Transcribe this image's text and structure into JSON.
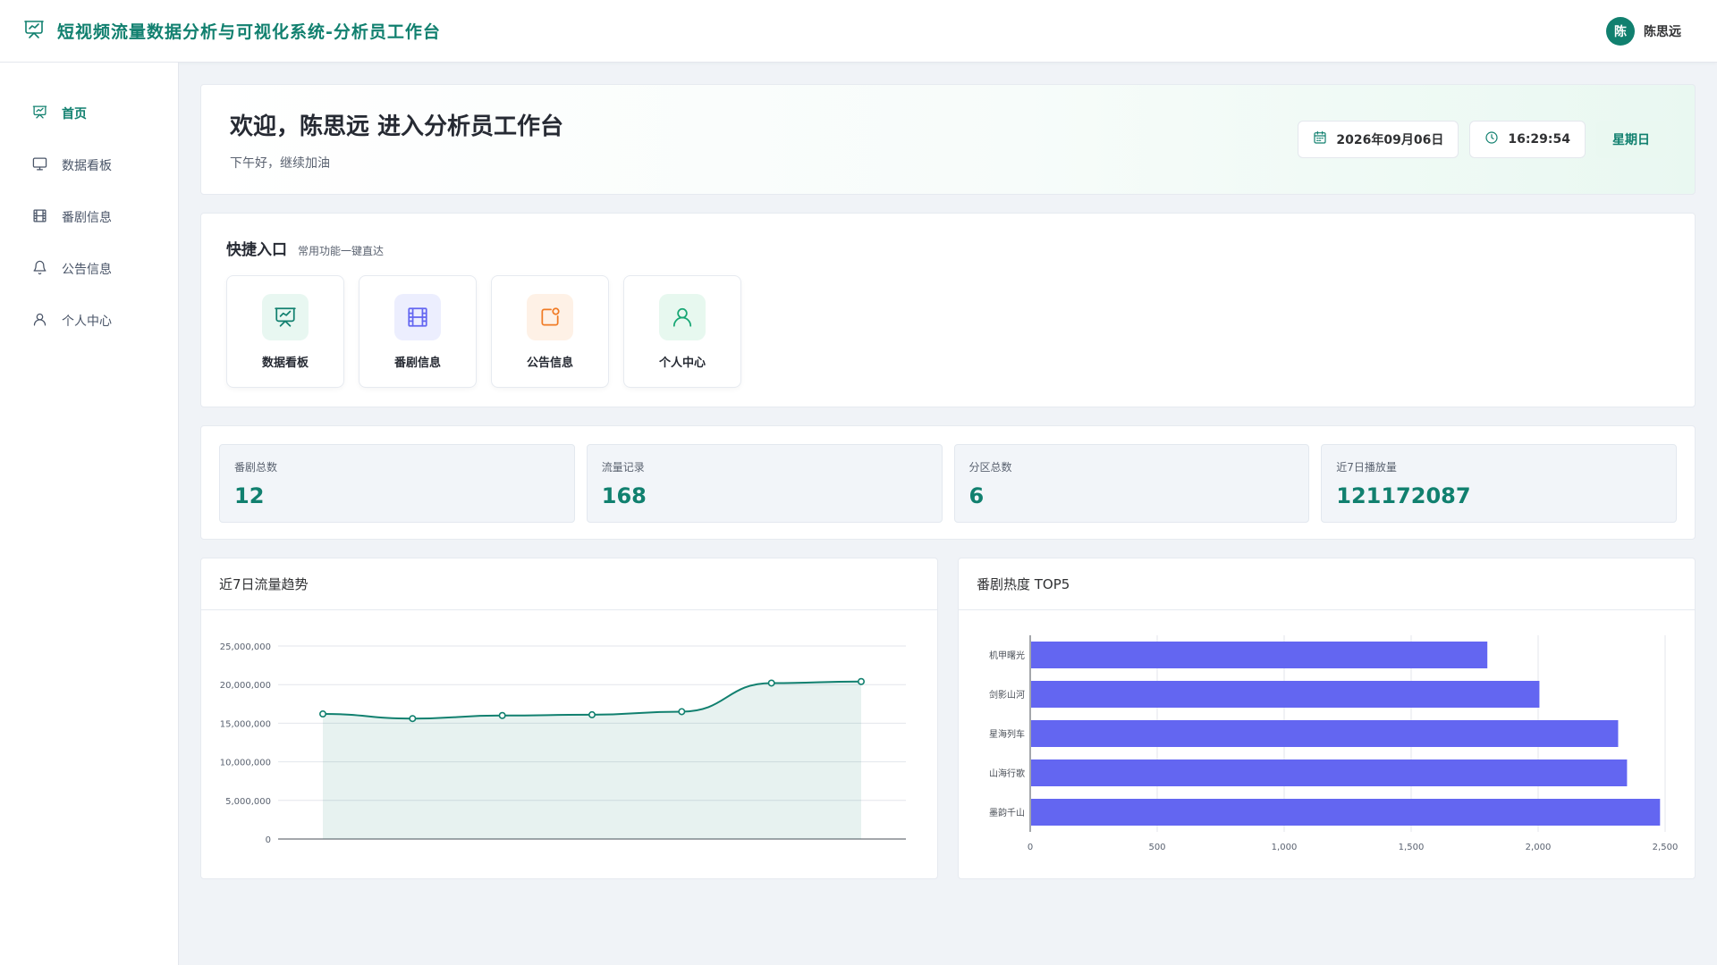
{
  "header": {
    "title": "短视频流量数据分析与可视化系统-分析员工作台",
    "user_avatar": "陈",
    "user_name": "陈思远",
    "logo_icon": "presentation-chart-icon"
  },
  "sidebar": {
    "items": [
      {
        "label": "首页",
        "icon": "presentation-chart-icon",
        "active": true
      },
      {
        "label": "数据看板",
        "icon": "monitor-icon",
        "active": false
      },
      {
        "label": "番剧信息",
        "icon": "film-grid-icon",
        "active": false
      },
      {
        "label": "公告信息",
        "icon": "bell-icon",
        "active": false
      },
      {
        "label": "个人中心",
        "icon": "user-icon",
        "active": false
      }
    ]
  },
  "welcome": {
    "title": "欢迎，陈思远 进入分析员工作台",
    "subtitle": "下午好，继续加油",
    "date": "2026年09月06日",
    "time": "16:29:54",
    "weekday": "星期日"
  },
  "quick": {
    "title": "快捷入口",
    "subtitle": "常用功能一键直达",
    "tiles": [
      {
        "label": "数据看板",
        "icon": "presentation-chart-icon",
        "color": "#11806f",
        "bg": "#e8f7f1"
      },
      {
        "label": "番剧信息",
        "icon": "film-grid-icon",
        "color": "#6366f1",
        "bg": "#eceefe"
      },
      {
        "label": "公告信息",
        "icon": "notice-icon",
        "color": "#f07a24",
        "bg": "#fef1e6"
      },
      {
        "label": "个人中心",
        "icon": "user-icon",
        "color": "#16a673",
        "bg": "#e7f8ef"
      }
    ]
  },
  "stats": [
    {
      "label": "番剧总数",
      "value": "12"
    },
    {
      "label": "流量记录",
      "value": "168"
    },
    {
      "label": "分区总数",
      "value": "6"
    },
    {
      "label": "近7日播放量",
      "value": "121172087"
    }
  ],
  "chart_data": [
    {
      "type": "area",
      "title": "近7日流量趋势",
      "ylim": [
        0,
        25000000
      ],
      "yticks": [
        "0",
        "5,000,000",
        "10,000,000",
        "15,000,000",
        "20,000,000",
        "25,000,000"
      ],
      "values": [
        16200000,
        15600000,
        16000000,
        16100000,
        16500000,
        20200000,
        20400000
      ],
      "color": "#11806f",
      "grid": true
    },
    {
      "type": "bar",
      "orientation": "horizontal",
      "title": "番剧热度 TOP5",
      "categories": [
        "机甲曙光",
        "剑影山河",
        "星海列车",
        "山海行歌",
        "墨韵千山"
      ],
      "values": [
        1800,
        2005,
        2315,
        2350,
        2480
      ],
      "xlim": [
        0,
        2500
      ],
      "xticks": [
        "0",
        "500",
        "1,000",
        "1,500",
        "2,000",
        "2,500"
      ],
      "color": "#6366f1",
      "grid": true
    }
  ]
}
